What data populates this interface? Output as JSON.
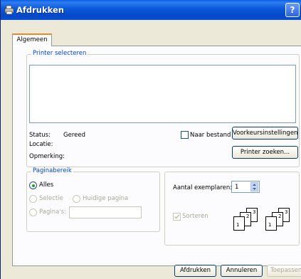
{
  "window": {
    "title": "Afdrukken",
    "help_label": "?"
  },
  "tabs": [
    {
      "label": "Algemeen"
    }
  ],
  "printer_group": {
    "title": "Printer selecteren",
    "status_label": "Status:",
    "status_value": "Gereed",
    "location_label": "Locatie:",
    "location_value": "",
    "comment_label": "Opmerking:",
    "comment_value": "",
    "print_to_file_label": "Naar bestand",
    "print_to_file_checked": false,
    "preferences_button": "Voorkeursinstellingen",
    "find_printer_button": "Printer zoeken..."
  },
  "page_range": {
    "title": "Paginabereik",
    "all_label": "Alles",
    "selection_label": "Selectie",
    "current_page_label": "Huidige pagina",
    "pages_label": "Pagina's:",
    "pages_value": "",
    "selected": "Alles"
  },
  "copies": {
    "label": "Aantal exemplaren:",
    "value": "1",
    "collate_label": "Sorteren",
    "collate_checked": true,
    "collate_enabled": false,
    "page_numbers": [
      "1",
      "2",
      "3"
    ]
  },
  "footer": {
    "print_button": "Afdrukken",
    "cancel_button": "Annuleren",
    "apply_button": "Toepassen"
  },
  "colors": {
    "titlebar": "#0b58d8",
    "group_title": "#0046d5",
    "dialog_bg": "#ece9d8"
  }
}
